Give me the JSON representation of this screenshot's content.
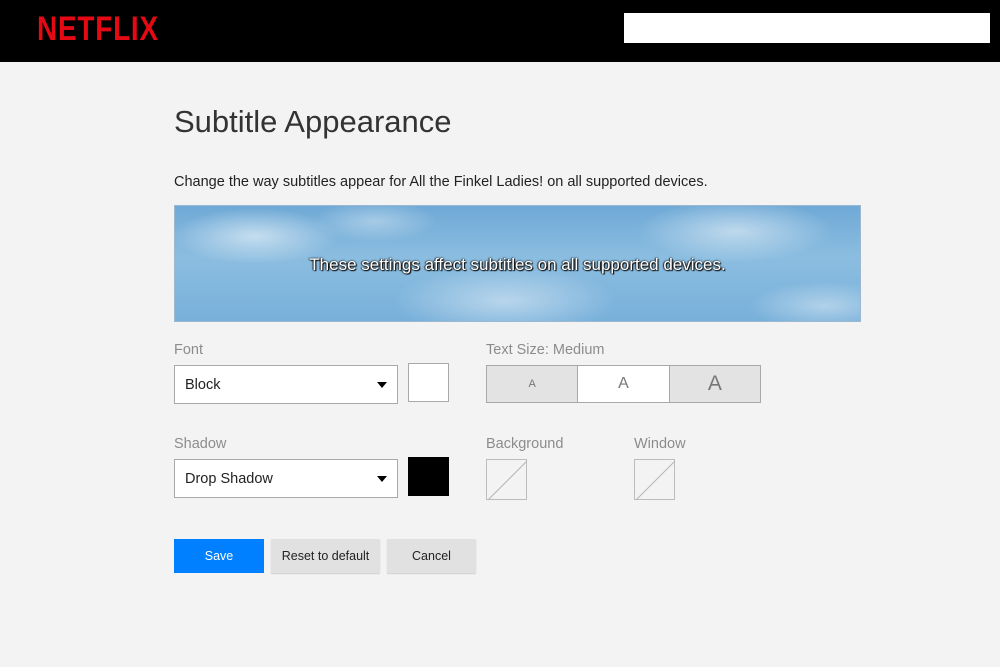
{
  "header": {
    "logo_text": "NETFLIX",
    "brand_color": "#e50914",
    "search_value": ""
  },
  "page": {
    "title": "Subtitle Appearance",
    "description": "Change the way subtitles appear for All the Finkel Ladies! on all supported devices."
  },
  "preview": {
    "text": "These settings affect subtitles on all supported devices."
  },
  "font": {
    "label": "Font",
    "selected": "Block",
    "color": "#ffffff"
  },
  "text_size": {
    "label": "Text Size: Medium",
    "options": [
      "A",
      "A",
      "A"
    ],
    "selected_index": 1
  },
  "shadow": {
    "label": "Shadow",
    "selected": "Drop Shadow",
    "color": "#000000"
  },
  "background": {
    "label": "Background",
    "swatch": "none-icon"
  },
  "window": {
    "label": "Window",
    "swatch": "none-icon"
  },
  "actions": {
    "save_label": "Save",
    "reset_label": "Reset to default",
    "cancel_label": "Cancel",
    "save_color": "#0080ff"
  }
}
